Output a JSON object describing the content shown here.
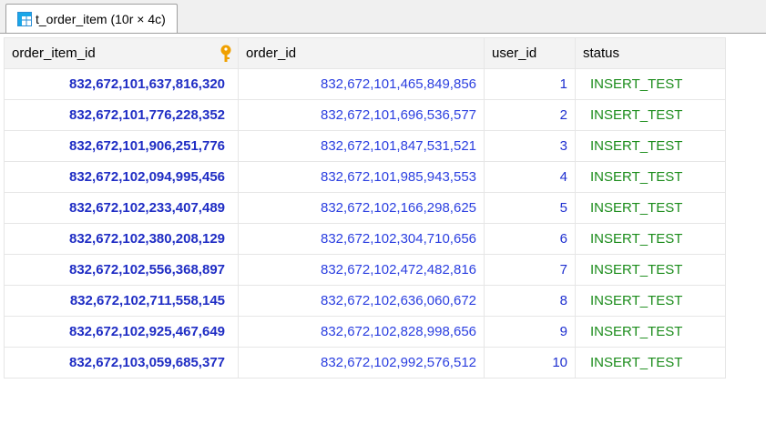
{
  "tab": {
    "label": "t_order_item (10r × 4c)",
    "icon": "table-grid-icon"
  },
  "columns": [
    {
      "key": "order_item_id",
      "label": "order_item_id",
      "icon": "primary-key-icon"
    },
    {
      "key": "order_id",
      "label": "order_id"
    },
    {
      "key": "user_id",
      "label": "user_id"
    },
    {
      "key": "status",
      "label": "status"
    }
  ],
  "rows": [
    {
      "order_item_id": "832,672,101,637,816,320",
      "order_id": "832,672,101,465,849,856",
      "user_id": "1",
      "status": "INSERT_TEST"
    },
    {
      "order_item_id": "832,672,101,776,228,352",
      "order_id": "832,672,101,696,536,577",
      "user_id": "2",
      "status": "INSERT_TEST"
    },
    {
      "order_item_id": "832,672,101,906,251,776",
      "order_id": "832,672,101,847,531,521",
      "user_id": "3",
      "status": "INSERT_TEST"
    },
    {
      "order_item_id": "832,672,102,094,995,456",
      "order_id": "832,672,101,985,943,553",
      "user_id": "4",
      "status": "INSERT_TEST"
    },
    {
      "order_item_id": "832,672,102,233,407,489",
      "order_id": "832,672,102,166,298,625",
      "user_id": "5",
      "status": "INSERT_TEST"
    },
    {
      "order_item_id": "832,672,102,380,208,129",
      "order_id": "832,672,102,304,710,656",
      "user_id": "6",
      "status": "INSERT_TEST"
    },
    {
      "order_item_id": "832,672,102,556,368,897",
      "order_id": "832,672,102,472,482,816",
      "user_id": "7",
      "status": "INSERT_TEST"
    },
    {
      "order_item_id": "832,672,102,711,558,145",
      "order_id": "832,672,102,636,060,672",
      "user_id": "8",
      "status": "INSERT_TEST"
    },
    {
      "order_item_id": "832,672,102,925,467,649",
      "order_id": "832,672,102,828,998,656",
      "user_id": "9",
      "status": "INSERT_TEST"
    },
    {
      "order_item_id": "832,672,103,059,685,377",
      "order_id": "832,672,102,992,576,512",
      "user_id": "10",
      "status": "INSERT_TEST"
    }
  ],
  "colors": {
    "id_text": "#1f2dc4",
    "number_text": "#2b3fe0",
    "status_text": "#1b8c1b",
    "key_icon": "#f0a000",
    "header_bg": "#f3f3f3"
  }
}
